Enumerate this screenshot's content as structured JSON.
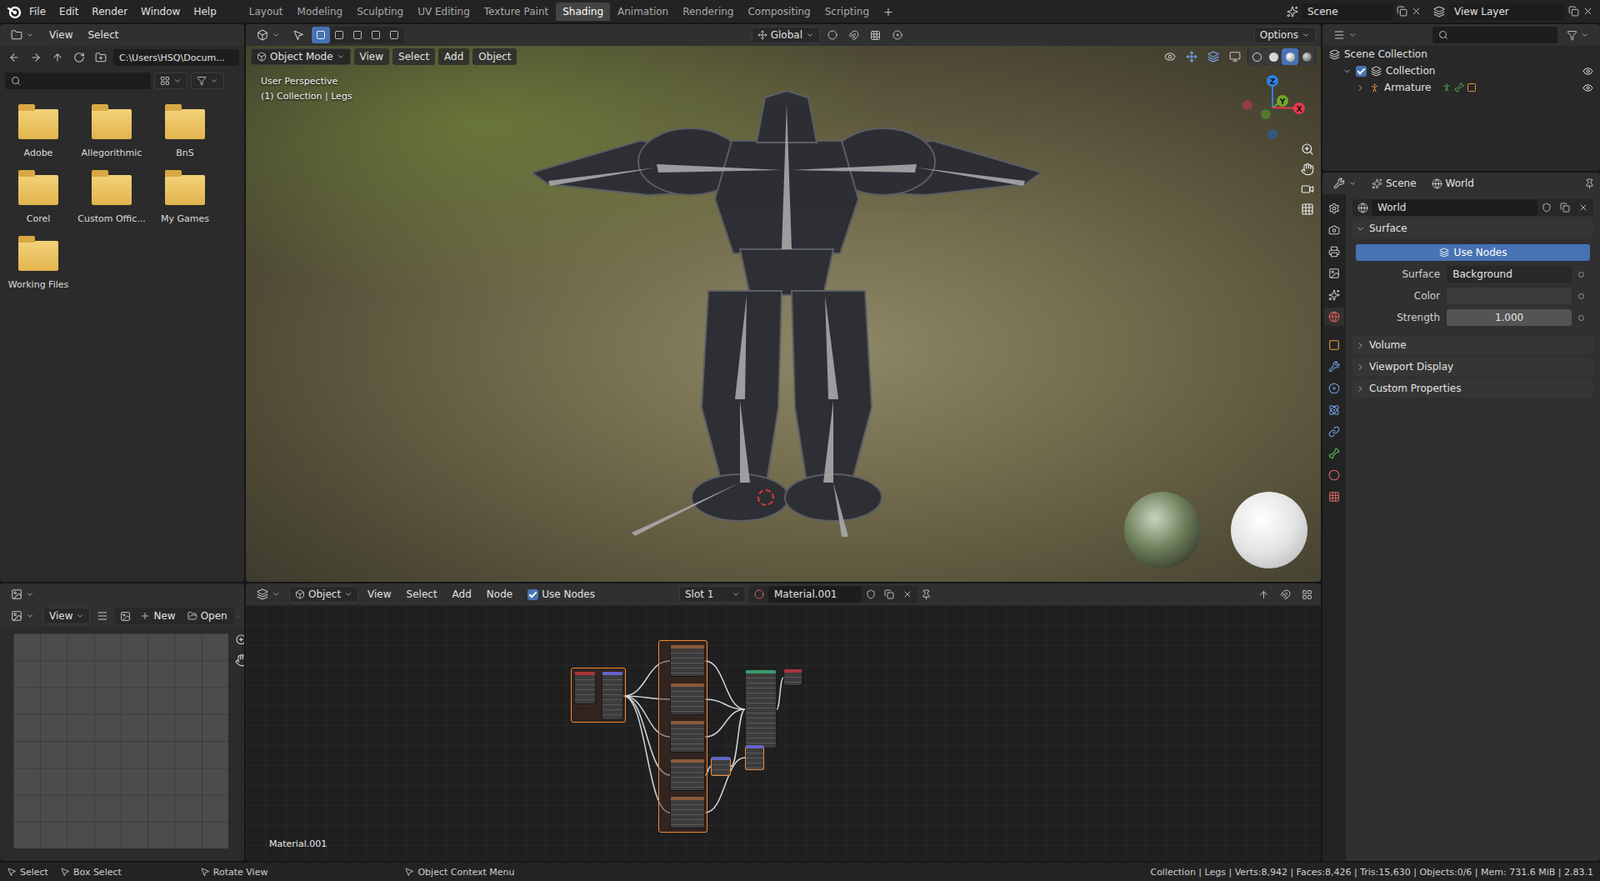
{
  "topbar": {
    "menu": [
      "File",
      "Edit",
      "Render",
      "Window",
      "Help"
    ],
    "workspaces": [
      {
        "label": "Layout",
        "selected": false
      },
      {
        "label": "Modeling",
        "selected": false
      },
      {
        "label": "Sculpting",
        "selected": false
      },
      {
        "label": "UV Editing",
        "selected": false
      },
      {
        "label": "Texture Paint",
        "selected": false
      },
      {
        "label": "Shading",
        "selected": true
      },
      {
        "label": "Animation",
        "selected": false
      },
      {
        "label": "Rendering",
        "selected": false
      },
      {
        "label": "Compositing",
        "selected": false
      },
      {
        "label": "Scripting",
        "selected": false
      }
    ],
    "add_workspace": "+",
    "scene": "Scene",
    "view_layer": "View Layer"
  },
  "file_browser": {
    "menus": [
      "View",
      "Select"
    ],
    "path": "C:\\Users\\HSQ\\Docum...",
    "folders": [
      "Adobe",
      "Allegorithmic",
      "BnS",
      "Corel",
      "Custom Offic...",
      "My Games",
      "Working Files"
    ]
  },
  "image_editor": {
    "menus": [
      "View"
    ],
    "new": "New",
    "open": "Open"
  },
  "viewport": {
    "mode": "Object Mode",
    "menus": [
      "View",
      "Select",
      "Add",
      "Object"
    ],
    "transform": "Global",
    "options": "Options",
    "overlay": [
      "User Perspective",
      "(1) Collection | Legs"
    ],
    "select_modes": [
      {
        "selected": true
      },
      {
        "selected": false
      },
      {
        "selected": false
      },
      {
        "selected": false
      },
      {
        "selected": false
      }
    ],
    "shading": [
      {
        "selected": false
      },
      {
        "selected": false
      },
      {
        "selected": true
      },
      {
        "selected": false
      }
    ],
    "gizmo": [
      {
        "label": "Z",
        "color": "#2f83e3"
      },
      {
        "label": "Y",
        "color": "#6ea92c"
      },
      {
        "label": "X",
        "color": "#e8384f"
      }
    ]
  },
  "node_editor": {
    "type": "Object",
    "menus": [
      "View",
      "Select",
      "Add",
      "Node"
    ],
    "use_nodes": {
      "label": "Use Nodes",
      "checked": true
    },
    "slot": "Slot 1",
    "material": "Material.001",
    "label": "Material.001",
    "nodes": [
      {
        "kind": "frame",
        "selected": true,
        "color": "#3a2a22"
      },
      {
        "kind": "node",
        "selected": false,
        "color": "#a8343b"
      },
      {
        "kind": "node",
        "selected": false,
        "color": "#6363c7"
      },
      {
        "kind": "frame",
        "selected": true,
        "color": "#3a2a22"
      },
      {
        "kind": "node",
        "selected": false,
        "color": "#8a5a3a"
      },
      {
        "kind": "node",
        "selected": false,
        "color": "#8a5a3a"
      },
      {
        "kind": "node",
        "selected": false,
        "color": "#8a5a3a"
      },
      {
        "kind": "node",
        "selected": false,
        "color": "#8a5a3a"
      },
      {
        "kind": "node",
        "selected": false,
        "color": "#8a5a3a"
      },
      {
        "kind": "node",
        "selected": false,
        "color": "#3a9b6e"
      },
      {
        "kind": "node",
        "selected": false,
        "color": "#a8343b"
      },
      {
        "kind": "node",
        "selected": true,
        "color": "#6363c7"
      },
      {
        "kind": "node",
        "selected": true,
        "color": "#6363c7"
      }
    ],
    "links": [
      [
        2,
        4
      ],
      [
        2,
        5
      ],
      [
        2,
        6
      ],
      [
        2,
        7
      ],
      [
        2,
        8
      ],
      [
        4,
        9
      ],
      [
        5,
        9
      ],
      [
        6,
        9
      ],
      [
        7,
        11
      ],
      [
        8,
        12
      ],
      [
        11,
        9
      ],
      [
        12,
        9
      ],
      [
        9,
        10
      ]
    ]
  },
  "outliner": {
    "items": [
      {
        "label": "Scene Collection",
        "kind": "root",
        "expanded": true,
        "checked": false,
        "visible": false
      },
      {
        "label": "Collection",
        "kind": "collection",
        "expanded": true,
        "checked": true,
        "visible": true
      },
      {
        "label": "Armature",
        "kind": "object",
        "expanded": false,
        "checked": false,
        "visible": true
      }
    ]
  },
  "properties": {
    "breadcrumb": [
      "Scene",
      "World"
    ],
    "tabs": [
      {
        "selected": false
      },
      {
        "selected": false
      },
      {
        "selected": false
      },
      {
        "selected": false
      },
      {
        "selected": false
      },
      {
        "selected": true
      },
      {
        "selected": false
      },
      {
        "selected": false
      },
      {
        "selected": false
      },
      {
        "selected": false
      },
      {
        "selected": false
      },
      {
        "selected": false
      },
      {
        "selected": false
      },
      {
        "selected": false
      }
    ],
    "world": "World",
    "use_nodes": "Use Nodes",
    "panels": [
      {
        "label": "Surface",
        "expanded": true
      },
      {
        "label": "Volume",
        "expanded": false
      },
      {
        "label": "Viewport Display",
        "expanded": false
      },
      {
        "label": "Custom Properties",
        "expanded": false
      }
    ],
    "fields": [
      {
        "label": "Surface",
        "kind": "dropdown",
        "value": "Background",
        "swatch": ""
      },
      {
        "label": "Color",
        "kind": "color",
        "value": "",
        "swatch": "#3b3b3b"
      },
      {
        "label": "Strength",
        "kind": "number",
        "value": "1.000",
        "swatch": ""
      }
    ]
  },
  "status_bar": {
    "items": [
      "Select",
      "Box Select",
      "Rotate View",
      "Object Context Menu"
    ],
    "stats": "Collection | Legs | Verts:8,942 | Faces:8,426 | Tris:15,630 | Objects:0/6 | Mem: 731.6 MiB | 2.83.1"
  }
}
